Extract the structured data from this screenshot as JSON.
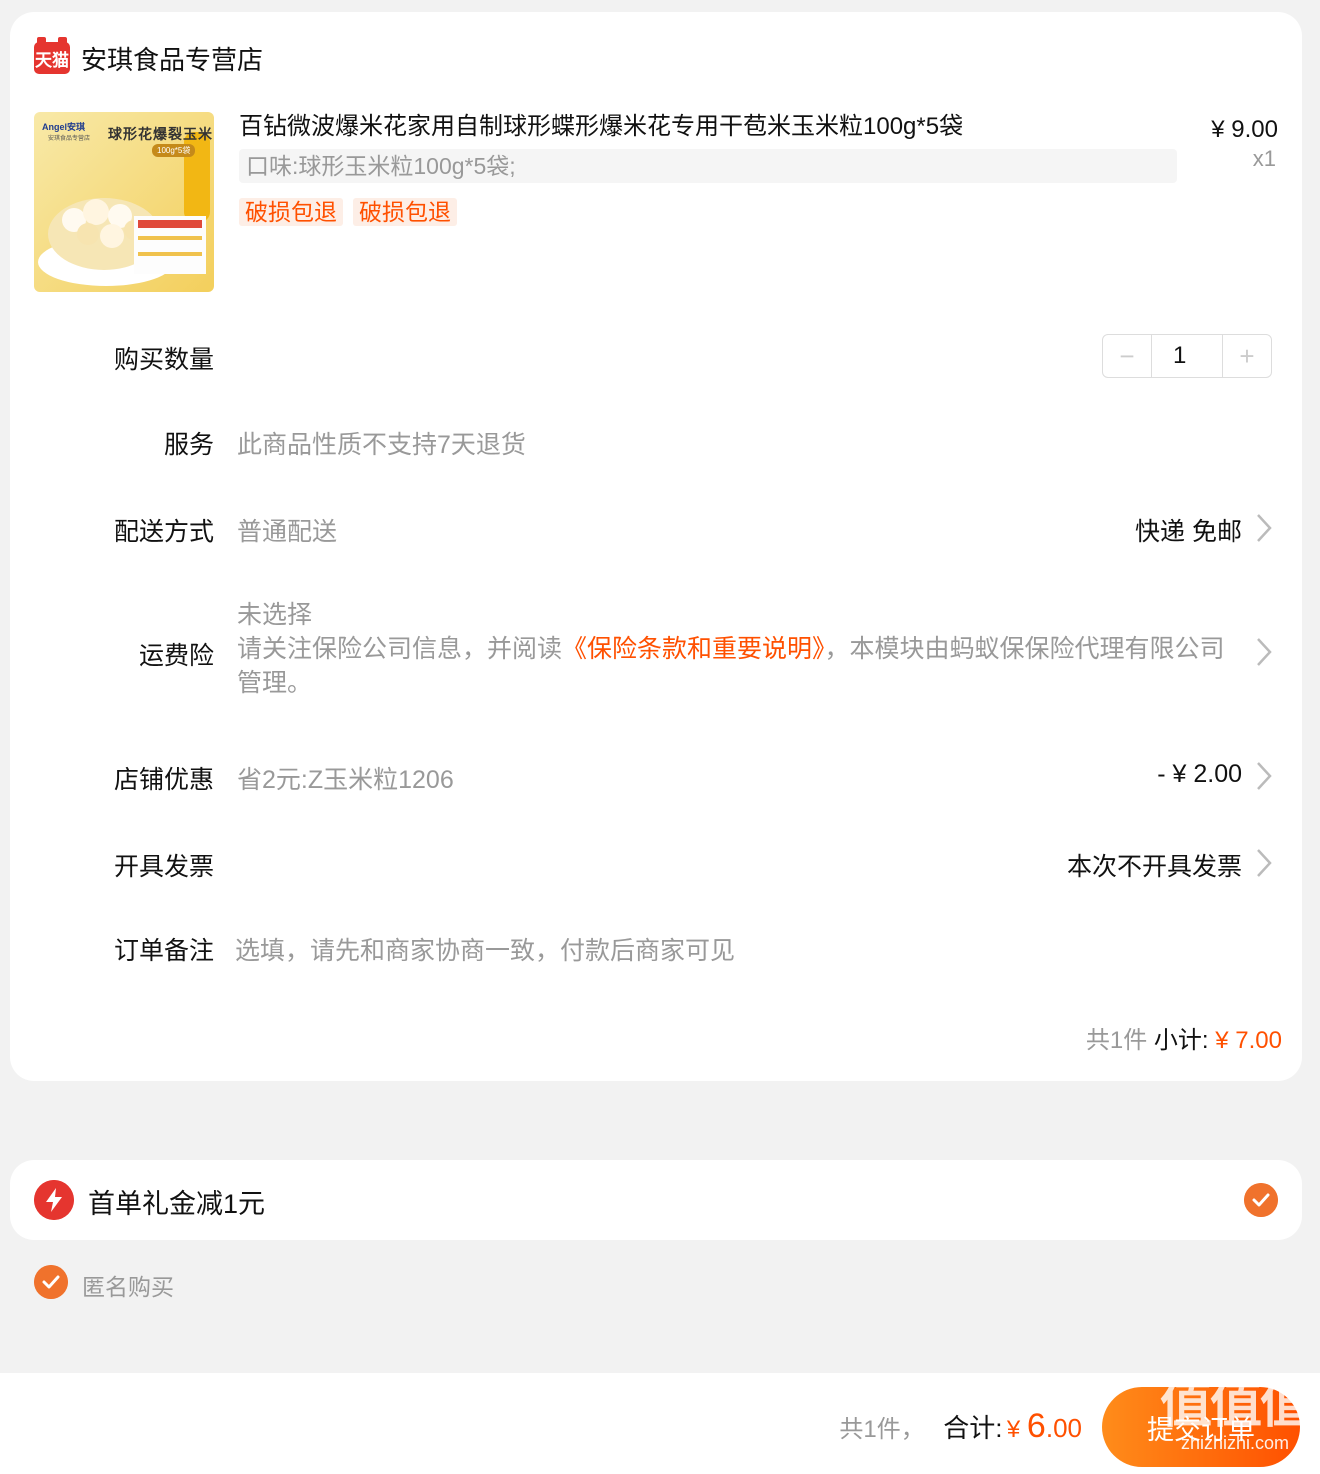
{
  "shop": {
    "badge": "天猫",
    "name": "安琪食品专营店"
  },
  "product": {
    "title": "百钻微波爆米花家用自制球形蝶形爆米花专用干苞米玉米粒100g*5袋",
    "sku": "口味:球形玉米粒100g*5袋;",
    "tags": [
      "破损包退",
      "破损包退"
    ],
    "price": "¥ 9.00",
    "quantity_mark": "x1",
    "image": {
      "brand": "Angel安琪",
      "brand_sub": "安琪食品专营店",
      "headline": "球形花爆裂玉米",
      "spec": "100g*5袋"
    }
  },
  "quantity": {
    "label": "购买数量",
    "value": "1",
    "minus": "−",
    "plus": "+"
  },
  "service": {
    "label": "服务",
    "value": "此商品性质不支持7天退货"
  },
  "delivery": {
    "label": "配送方式",
    "value": "普通配送",
    "right": "快递 免邮"
  },
  "shipping_insurance": {
    "label": "运费险",
    "status": "未选择",
    "text_before": "请关注保险公司信息，并阅读",
    "link": "《保险条款和重要说明》",
    "text_after": "，本模块由蚂蚁保保险代理有限公司管理。"
  },
  "store_discount": {
    "label": "店铺优惠",
    "value": "省2元:Z玉米粒1206",
    "right": "- ¥ 2.00"
  },
  "invoice": {
    "label": "开具发票",
    "right": "本次不开具发票"
  },
  "note": {
    "label": "订单备注",
    "placeholder": "选填，请先和商家协商一致，付款后商家可见"
  },
  "subtotal": {
    "count": "共1件",
    "label": "小计:",
    "amount": "¥ 7.00"
  },
  "gift": {
    "text": "首单礼金减1元",
    "checked": true
  },
  "anonymous": {
    "text": "匿名购买",
    "checked": true
  },
  "footer": {
    "count": "共1件，",
    "total_label": "合计:",
    "currency": "¥ ",
    "amount_int": "6",
    "amount_dec": ".00",
    "submit": "提交订单",
    "watermark_big": "值值值",
    "watermark_small": "zhizhizhi.com"
  },
  "colors": {
    "accent": "#ff5000",
    "tmall_red": "#e5352f",
    "check_orange": "#f0722c",
    "page_bg": "#f2f2f2"
  }
}
